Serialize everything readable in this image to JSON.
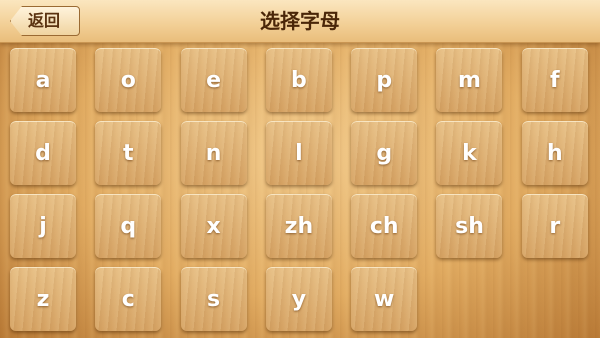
{
  "header": {
    "back_label": "返回",
    "title": "选择字母"
  },
  "letters": [
    "a",
    "o",
    "e",
    "b",
    "p",
    "m",
    "f",
    "d",
    "t",
    "n",
    "l",
    "g",
    "k",
    "h",
    "j",
    "q",
    "x",
    "zh",
    "ch",
    "sh",
    "r",
    "z",
    "c",
    "s",
    "y",
    "w"
  ]
}
